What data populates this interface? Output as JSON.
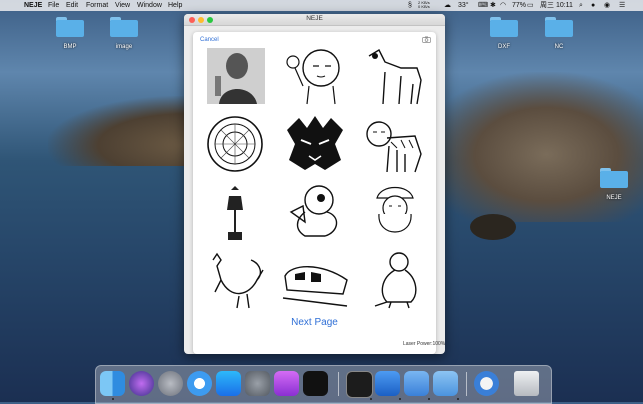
{
  "menubar": {
    "app_name": "NEJE",
    "menus": [
      "File",
      "Edit",
      "Format",
      "View",
      "Window",
      "Help"
    ],
    "net_up": "2 KB/s",
    "net_down": "0 KB/s",
    "temperature": "33°",
    "battery": "77%",
    "clock": "周三 10:11"
  },
  "desktop": {
    "icons": [
      {
        "label": "BMP"
      },
      {
        "label": "image"
      },
      {
        "label": "DXF"
      },
      {
        "label": "NC"
      },
      {
        "label": "NEJE"
      }
    ]
  },
  "window": {
    "title": "NEJE",
    "cancel_label": "Cancel",
    "next_page_label": "Next Page",
    "laser_power_label": "Laser Power:100%",
    "images": [
      "portrait-photo",
      "cartoon-boy-with-lollipop",
      "horse-drawing",
      "ornamental-disc-pattern",
      "tribal-tiger-face",
      "tiger-drawing",
      "street-lamp",
      "chick-drawing",
      "santa-claus-drawing",
      "rooster-drawing",
      "train-drawing",
      "dinosaur-drawing"
    ]
  },
  "dock": {
    "apps": [
      "Finder",
      "Siri",
      "Launchpad",
      "Safari",
      "App Store",
      "System Preferences",
      "Podcasts",
      "TV",
      "Terminal",
      "Xcode",
      "Preview",
      "NEJE",
      "Screen Recorder",
      "Trash"
    ]
  },
  "colors": {
    "accent": "#2f6fd6",
    "folder": "#5ab0e8"
  }
}
